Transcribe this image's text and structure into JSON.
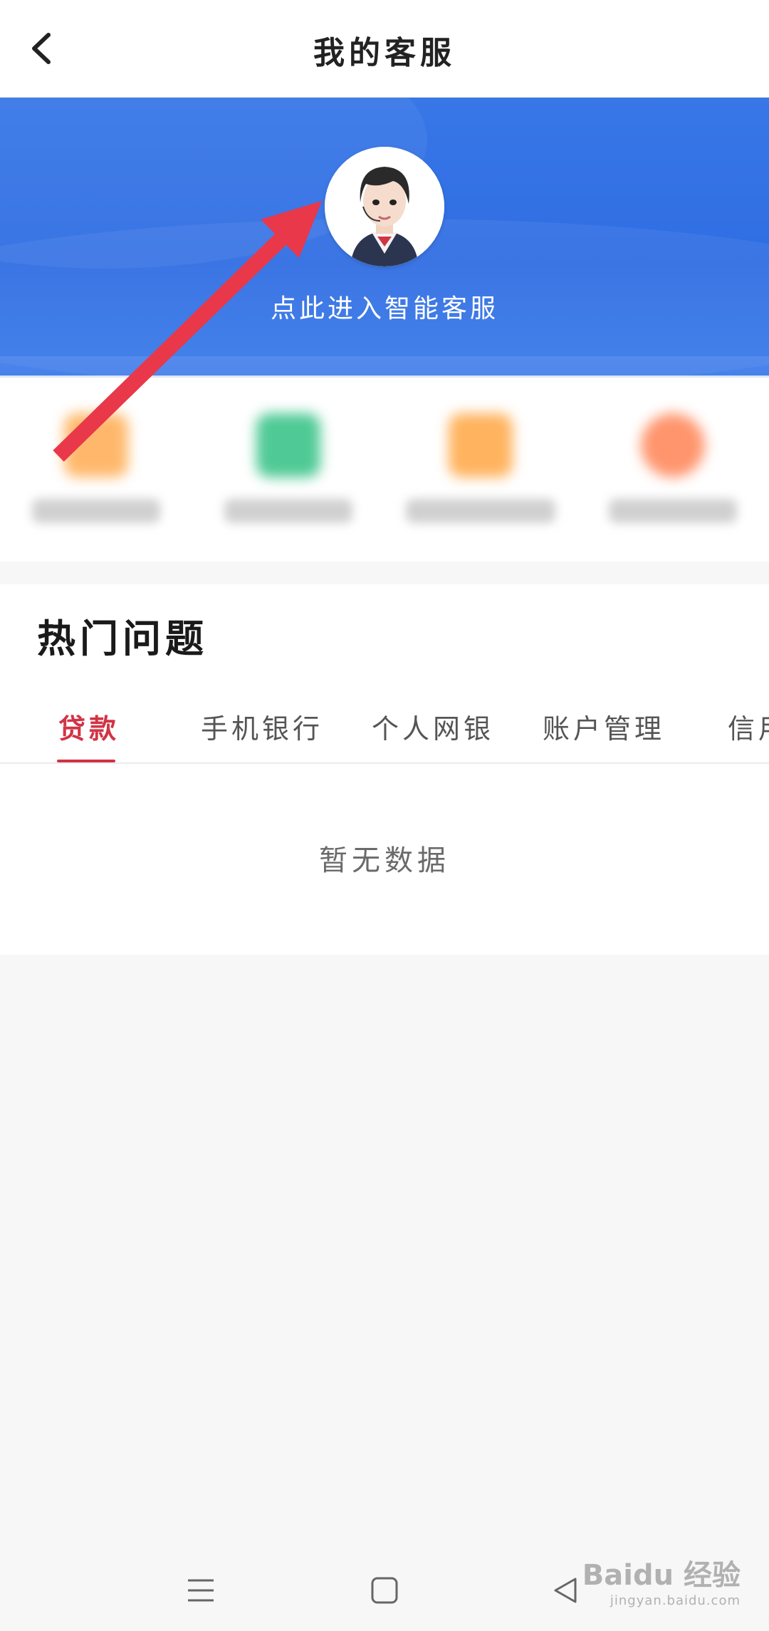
{
  "header": {
    "title": "我的客服",
    "back_icon": "chevron-left-icon"
  },
  "banner": {
    "avatar_icon": "customer-service-avatar",
    "entry_text": "点此进入智能客服",
    "color": "#2f6de3"
  },
  "shortcuts": [
    {
      "icon_color": "#ffb15c"
    },
    {
      "icon_color": "#3cc48a"
    },
    {
      "icon_color": "#ffab4d"
    },
    {
      "icon_color": "#ff8a5e"
    }
  ],
  "hot_questions": {
    "title": "热门问题",
    "tabs": [
      {
        "label": "贷款",
        "active": true
      },
      {
        "label": "手机银行",
        "active": false
      },
      {
        "label": "个人网银",
        "active": false
      },
      {
        "label": "账户管理",
        "active": false
      },
      {
        "label": "信用",
        "active": false
      }
    ],
    "accent_color": "#d23345",
    "empty_text": "暂无数据"
  },
  "system_nav": {
    "menu_icon": "menu-icon",
    "home_icon": "home-square-icon",
    "back_icon": "back-triangle-icon"
  },
  "watermark": {
    "brand": "Baidu 经验",
    "url": "jingyan.baidu.com"
  }
}
